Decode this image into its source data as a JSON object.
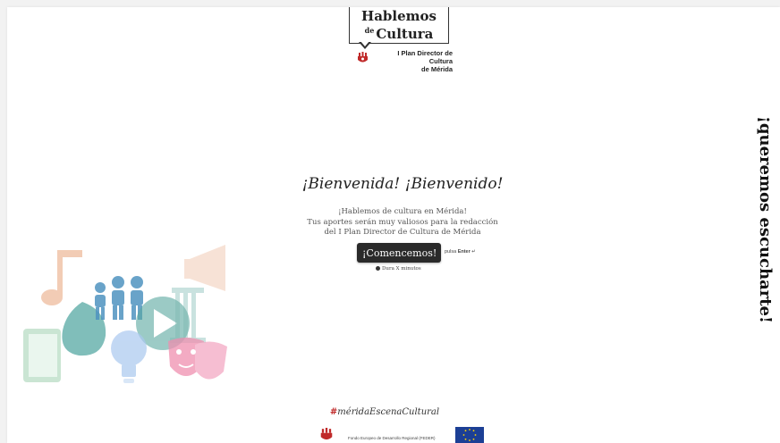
{
  "logo": {
    "line1": "Hablemos",
    "line2_small": "de",
    "line2": "Cultura",
    "subtitle_line1": "I Plan Director de Cultura",
    "subtitle_line2": "de Mérida"
  },
  "welcome": {
    "title": "¡Bienvenida! ¡Bienvenido!",
    "line1": "¡Hablemos de cultura en Mérida!",
    "line2": "Tus aportes serán muy valiosos para la redacción",
    "line3": "del I Plan Director de Cultura de Mérida"
  },
  "start": {
    "button_label": "¡Comencemos!",
    "hint_prefix": "pulsa",
    "hint_key": "Enter",
    "hint_symbol": "↵",
    "duration": "Dura X minutos"
  },
  "tagline": "¡queremos escucharte!",
  "footer": {
    "hashtag_mark": "#",
    "hashtag_text": "méridaEscenaCultural",
    "feder_text": "Fondo Europeo de Desarrollo Regional (FEDER)"
  },
  "colors": {
    "accent_red": "#c02a2a",
    "button_bg": "#2a2a2a",
    "eu_blue": "#1c3f95"
  }
}
